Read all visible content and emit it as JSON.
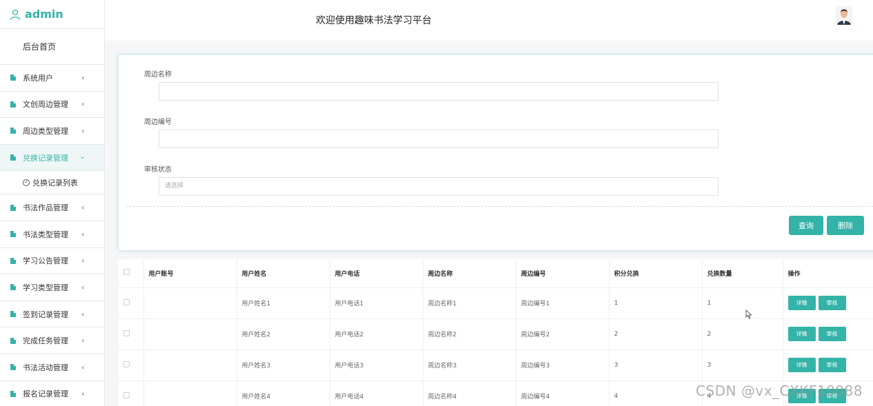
{
  "brand": {
    "name": "admin"
  },
  "sidebar": {
    "home": "后台首页",
    "items": [
      {
        "label": "系统用户"
      },
      {
        "label": "文创周边管理"
      },
      {
        "label": "周边类型管理"
      },
      {
        "label": "兑换记录管理",
        "active": true
      },
      {
        "label": "书法作品管理"
      },
      {
        "label": "书法类型管理"
      },
      {
        "label": "学习公告管理"
      },
      {
        "label": "学习类型管理"
      },
      {
        "label": "签到记录管理"
      },
      {
        "label": "完成任务管理"
      },
      {
        "label": "书法活动管理"
      },
      {
        "label": "报名记录管理"
      }
    ],
    "submenu": {
      "label": "兑换记录列表"
    }
  },
  "header": {
    "title": "欢迎使用趣味书法学习平台"
  },
  "search": {
    "fields": [
      {
        "label": "周边名称",
        "value": "",
        "placeholder": ""
      },
      {
        "label": "周边编号",
        "value": "",
        "placeholder": ""
      },
      {
        "label": "审核状态",
        "value": "",
        "placeholder": "请选择"
      }
    ],
    "query_button": "查询",
    "delete_button": "删除"
  },
  "table": {
    "columns": [
      "用户账号",
      "用户姓名",
      "用户电话",
      "周边名称",
      "周边编号",
      "积分兑换",
      "兑换数量",
      "操作"
    ],
    "rows": [
      {
        "account": "",
        "name": "用户姓名1",
        "phone": "用户电话1",
        "item_name": "周边名称1",
        "item_no": "周边编号1",
        "points": "1",
        "qty": "1"
      },
      {
        "account": "",
        "name": "用户姓名2",
        "phone": "用户电话2",
        "item_name": "周边名称2",
        "item_no": "周边编号2",
        "points": "2",
        "qty": "2"
      },
      {
        "account": "",
        "name": "用户姓名3",
        "phone": "用户电话3",
        "item_name": "周边名称3",
        "item_no": "周边编号3",
        "points": "3",
        "qty": "3"
      },
      {
        "account": "",
        "name": "用户姓名4",
        "phone": "用户电话4",
        "item_name": "周边名称4",
        "item_no": "周边编号4",
        "points": "4",
        "qty": "4"
      }
    ],
    "detail_button": "详情",
    "review_button": "审核"
  },
  "watermark": "CSDN @vx_CXKF10088",
  "colors": {
    "accent": "#34b3a8"
  }
}
